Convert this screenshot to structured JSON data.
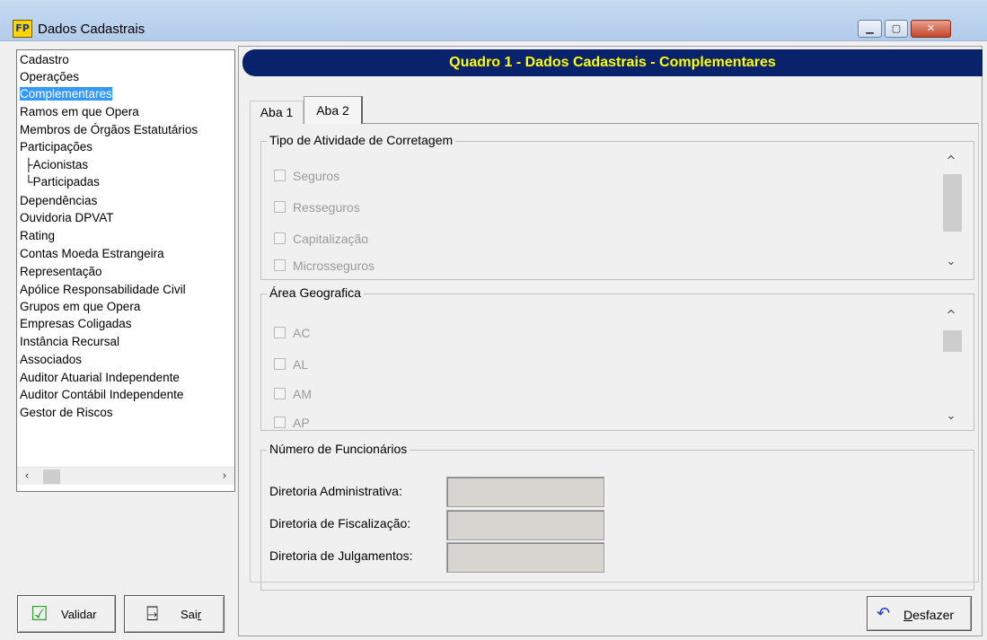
{
  "window": {
    "title": "Dados Cadastrais",
    "app_icon": "FP"
  },
  "sidebar": {
    "items": [
      {
        "label": "Cadastro",
        "level": 0
      },
      {
        "label": "Operações",
        "level": 0
      },
      {
        "label": "Complementares",
        "level": 0,
        "selected": true
      },
      {
        "label": "Ramos em que Opera",
        "level": 0
      },
      {
        "label": "Membros de Órgãos Estatutários",
        "level": 0
      },
      {
        "label": "Participações",
        "level": 0
      },
      {
        "label": "Acionistas",
        "level": 1
      },
      {
        "label": "Participadas",
        "level": 1
      },
      {
        "label": "Dependências",
        "level": 0
      },
      {
        "label": "Ouvidoria DPVAT",
        "level": 0
      },
      {
        "label": "Rating",
        "level": 0
      },
      {
        "label": "Contas Moeda Estrangeira",
        "level": 0
      },
      {
        "label": "Representação",
        "level": 0
      },
      {
        "label": "Apólice Responsabilidade Civil",
        "level": 0
      },
      {
        "label": "Grupos em que Opera",
        "level": 0
      },
      {
        "label": "Empresas Coligadas",
        "level": 0
      },
      {
        "label": "Instância Recursal",
        "level": 0
      },
      {
        "label": "Associados",
        "level": 0
      },
      {
        "label": "Auditor Atuarial Independente",
        "level": 0
      },
      {
        "label": "Auditor Contábil Independente",
        "level": 0
      },
      {
        "label": "Gestor de Riscos",
        "level": 0
      }
    ]
  },
  "buttons": {
    "validar": "Validar",
    "sair_prefix": "Sai",
    "sair_hotkey": "r",
    "desfazer_hotkey": "D",
    "desfazer_rest": "esfazer"
  },
  "header": {
    "title": "Quadro 1 - Dados Cadastrais - Complementares"
  },
  "tabs": [
    {
      "label": "Aba 1"
    },
    {
      "label": "Aba 2",
      "active": true
    }
  ],
  "tipo_atividade": {
    "title": "Tipo de Atividade de Corretagem",
    "options": [
      "Seguros",
      "Resseguros",
      "Capitalização",
      "Microsseguros"
    ]
  },
  "area_geografica": {
    "title": "Área Geografica",
    "options": [
      "AC",
      "AL",
      "AM",
      "AP"
    ]
  },
  "funcionarios": {
    "title": "Número de Funcionários",
    "fields": [
      {
        "label": "Diretoria Administrativa:",
        "value": ""
      },
      {
        "label": "Diretoria de Fiscalização:",
        "value": ""
      },
      {
        "label": "Diretoria de Julgamentos:",
        "value": ""
      }
    ]
  },
  "colors": {
    "header_bg": "#08236b",
    "header_text": "#ffff00",
    "selection": "#3399ff"
  }
}
